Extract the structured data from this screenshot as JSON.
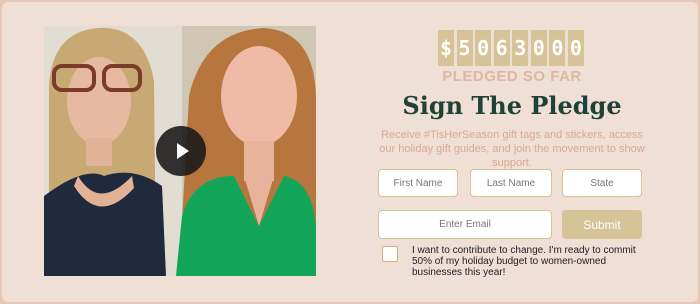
{
  "video": {
    "play_icon": "play-icon"
  },
  "counter": {
    "digits": [
      "$",
      "5",
      "0",
      "6",
      "3",
      "0",
      "0",
      "0"
    ],
    "label": "PLEDGED SO FAR"
  },
  "pledge": {
    "title": "Sign The Pledge",
    "description": "Receive #TisHerSeason gift tags and stickers, access our holiday gift guides, and join the movement to show support."
  },
  "form": {
    "first_name_placeholder": "First Name",
    "last_name_placeholder": "Last Name",
    "state_placeholder": "State",
    "email_placeholder": "Enter Email",
    "submit_label": "Submit",
    "consent_text": "I want to contribute to change. I'm ready to commit 50% of my holiday budget to women-owned businesses this year!"
  },
  "colors": {
    "background": "#efdfd5",
    "accent_gold": "#d7c398",
    "title_green": "#1f4238",
    "desc_peach": "#dba88f"
  }
}
